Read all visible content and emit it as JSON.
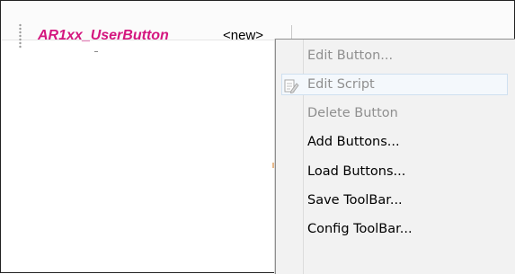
{
  "toolbar": {
    "button_label": "AR1xx_UserButton",
    "new_label": "<new>"
  },
  "context_menu": {
    "items": [
      {
        "label": "Edit Button...",
        "enabled": false
      },
      {
        "label": "Edit Script",
        "enabled": false,
        "icon": "edit-script-icon"
      },
      {
        "label": "Delete Button",
        "enabled": false
      },
      {
        "label": "Add Buttons...",
        "enabled": true
      },
      {
        "label": "Load Buttons...",
        "enabled": true
      },
      {
        "label": "Save ToolBar...",
        "enabled": true
      },
      {
        "label": "Config ToolBar...",
        "enabled": true
      }
    ]
  },
  "colors": {
    "button_label": "#d4167f",
    "disabled_text": "#8f8f8f",
    "enabled_text": "#000000"
  }
}
